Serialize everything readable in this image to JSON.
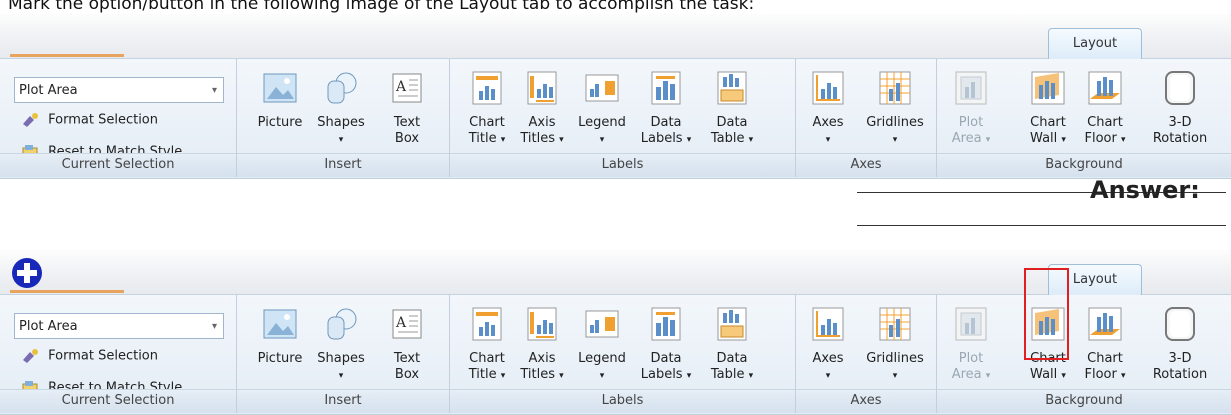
{
  "instruction": "Mark the option/button in the following image of the Layout tab to accomplish the task:",
  "answer_label": "Answer:",
  "tab": {
    "label": "Layout"
  },
  "current_selection": {
    "dropdown_value": "Plot Area",
    "format_selection": "Format Selection",
    "reset_to_match_style": "Reset to Match Style",
    "group_label": "Current Selection"
  },
  "insert": {
    "picture": "Picture",
    "shapes": "Shapes",
    "text_box_1": "Text",
    "text_box_2": "Box",
    "group_label": "Insert"
  },
  "labels": {
    "chart_title_1": "Chart",
    "chart_title_2": "Title",
    "axis_titles_1": "Axis",
    "axis_titles_2": "Titles",
    "legend": "Legend",
    "data_labels_1": "Data",
    "data_labels_2": "Labels",
    "data_table_1": "Data",
    "data_table_2": "Table",
    "group_label": "Labels"
  },
  "axes": {
    "axes": "Axes",
    "gridlines": "Gridlines",
    "group_label": "Axes"
  },
  "background": {
    "plot_area_1": "Plot",
    "plot_area_2": "Area",
    "chart_wall_1": "Chart",
    "chart_wall_2": "Wall",
    "chart_floor_1": "Chart",
    "chart_floor_2": "Floor",
    "rotation_1": "3-D",
    "rotation_2": "Rotation",
    "group_label": "Background"
  },
  "dropdown_arrow": "▾",
  "highlighted_button": "chart-wall-button",
  "colors": {
    "highlight": "#e02020",
    "marker": "#1828b8",
    "tab_accent": "#e8a35f"
  }
}
